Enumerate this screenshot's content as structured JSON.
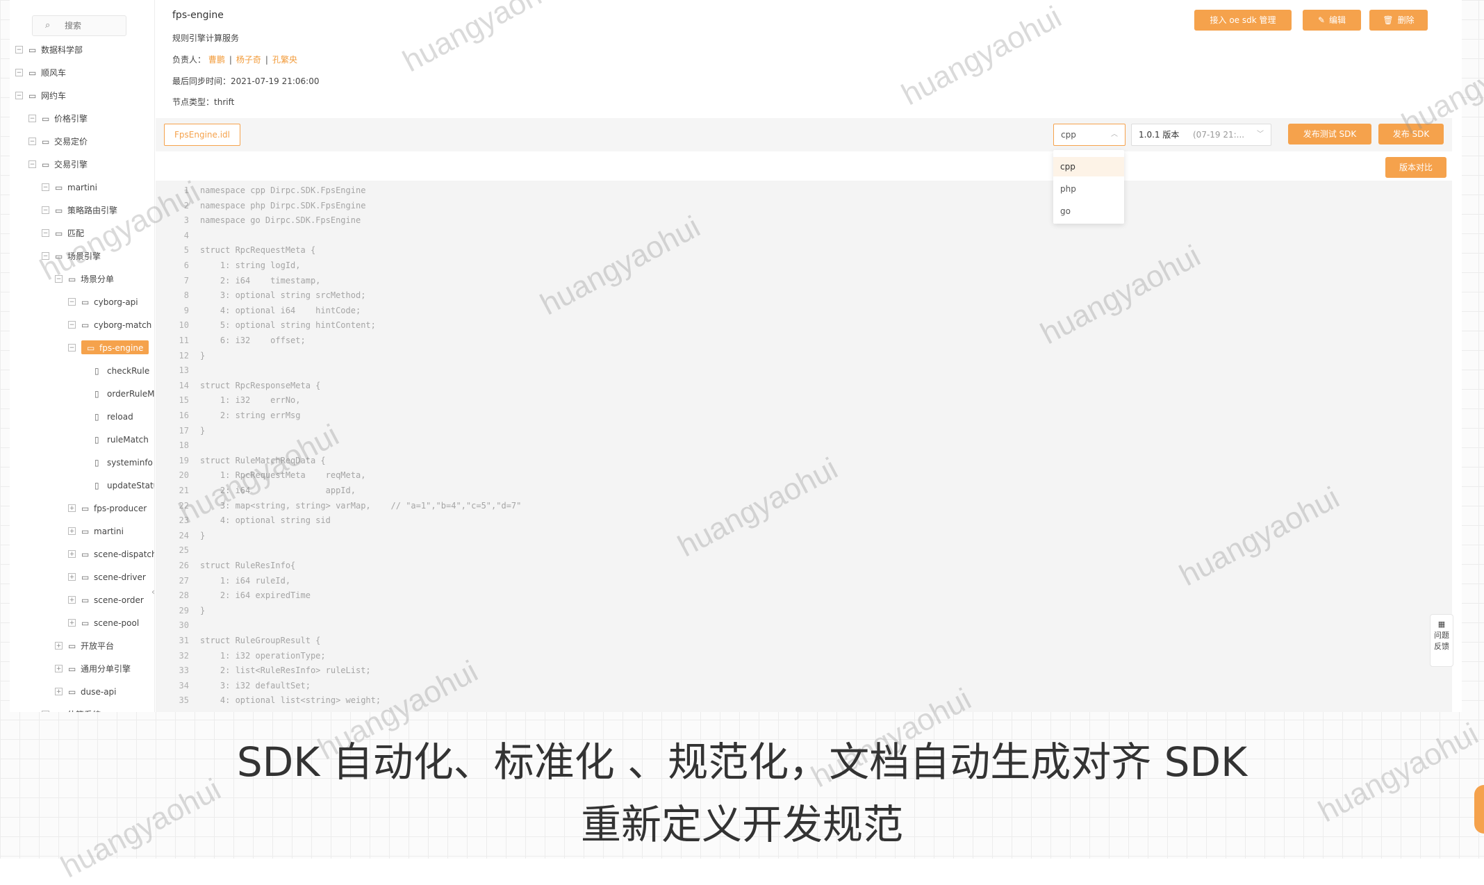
{
  "sidebar": {
    "search_placeholder": "搜索",
    "tree": [
      {
        "label": "数据科学部",
        "toggle": "-",
        "icon": "folder"
      },
      {
        "label": "顺风车",
        "toggle": "-",
        "icon": "folder"
      },
      {
        "label": "网约车",
        "toggle": "-",
        "icon": "folder"
      },
      {
        "label": "价格引擎",
        "toggle": "-",
        "icon": "folder"
      },
      {
        "label": "交易定价",
        "toggle": "-",
        "icon": "folder"
      },
      {
        "label": "交易引擎",
        "toggle": "-",
        "icon": "folder"
      },
      {
        "label": "martini",
        "toggle": "-",
        "icon": "folder"
      },
      {
        "label": "策略路由引擎",
        "toggle": "-",
        "icon": "folder"
      },
      {
        "label": "匹配",
        "toggle": "-",
        "icon": "folder"
      },
      {
        "label": "场景引擎",
        "toggle": "-",
        "icon": "folder"
      },
      {
        "label": "场景分单",
        "toggle": "-",
        "icon": "folder"
      },
      {
        "label": "cyborg-api",
        "toggle": "-",
        "icon": "folder"
      },
      {
        "label": "cyborg-match",
        "toggle": "-",
        "icon": "folder"
      },
      {
        "label": "fps-engine",
        "toggle": "-",
        "icon": "folder",
        "selected": true
      },
      {
        "label": "checkRule",
        "toggle": "",
        "icon": "file"
      },
      {
        "label": "orderRuleMatch",
        "toggle": "",
        "icon": "file"
      },
      {
        "label": "reload",
        "toggle": "",
        "icon": "file"
      },
      {
        "label": "ruleMatch",
        "toggle": "",
        "icon": "file"
      },
      {
        "label": "systeminfo",
        "toggle": "",
        "icon": "file"
      },
      {
        "label": "updateStatus",
        "toggle": "",
        "icon": "file"
      },
      {
        "label": "fps-producer",
        "toggle": "+",
        "icon": "folder"
      },
      {
        "label": "martini",
        "toggle": "+",
        "icon": "folder"
      },
      {
        "label": "scene-dispatch",
        "toggle": "+",
        "icon": "folder"
      },
      {
        "label": "scene-driver",
        "toggle": "+",
        "icon": "folder"
      },
      {
        "label": "scene-order",
        "toggle": "+",
        "icon": "folder"
      },
      {
        "label": "scene-pool",
        "toggle": "+",
        "icon": "folder"
      },
      {
        "label": "开放平台",
        "toggle": "+",
        "icon": "folder"
      },
      {
        "label": "通用分单引擎",
        "toggle": "+",
        "icon": "folder"
      },
      {
        "label": "duse-api",
        "toggle": "+",
        "icon": "folder"
      },
      {
        "label": "估算系统",
        "toggle": "-",
        "icon": "folder"
      }
    ]
  },
  "header": {
    "title": "fps-engine",
    "description": "规则引擎计算服务",
    "owners_label": "负责人：",
    "owners": [
      "曹鹏",
      "杨子奇",
      "孔繁央"
    ],
    "sync_label": "最后同步时间：",
    "sync_time": "2021-07-19 21:06:00",
    "type_label": "节点类型：",
    "type_value": "thrift"
  },
  "actions": {
    "access": "接入 oe sdk 管理",
    "edit": "编辑",
    "delete": "删除"
  },
  "toolbar": {
    "file_tab": "FpsEngine.idl",
    "language": "cpp",
    "version_number": "1.0.1 版本",
    "version_date": "(07-19 21:...",
    "publish_test": "发布测试 SDK",
    "publish": "发布 SDK",
    "compare": "版本对比"
  },
  "language_options": [
    "cpp",
    "php",
    "go"
  ],
  "code_lines": [
    "namespace cpp Dirpc.SDK.FpsEngine",
    "namespace php Dirpc.SDK.FpsEngine",
    "namespace go Dirpc.SDK.FpsEngine",
    "",
    "struct RpcRequestMeta {",
    "    1: string logId,",
    "    2: i64    timestamp,",
    "    3: optional string srcMethod;",
    "    4: optional i64    hintCode;",
    "    5: optional string hintContent;",
    "    6: i32    offset;",
    "}",
    "",
    "struct RpcResponseMeta {",
    "    1: i32    errNo,",
    "    2: string errMsg",
    "}",
    "",
    "struct RuleMatchReqData {",
    "    1: RpcRequestMeta    reqMeta,",
    "    2: i64               appId,",
    "    3: map<string, string> varMap,    // \"a=1\",\"b=4\",\"c=5\",\"d=7\"",
    "    4: optional string sid",
    "}",
    "",
    "struct RuleResInfo{",
    "    1: i64 ruleId,",
    "    2: i64 expiredTime",
    "}",
    "",
    "struct RuleGroupResult {",
    "    1: i32 operationType;",
    "    2: list<RuleResInfo> ruleList;",
    "    3: i32 defaultSet;",
    "    4: optional list<string> weight;"
  ],
  "feedback": {
    "line1": "问题",
    "line2": "反馈"
  },
  "watermark": "huangyaohui",
  "subtitles": {
    "line1": "SDK 自动化、标准化 、规范化，文档自动生成对齐 SDK",
    "line2": "重新定义开发规范"
  },
  "colors": {
    "accent": "#f5a24c",
    "owner_link": "#f29b3a"
  }
}
